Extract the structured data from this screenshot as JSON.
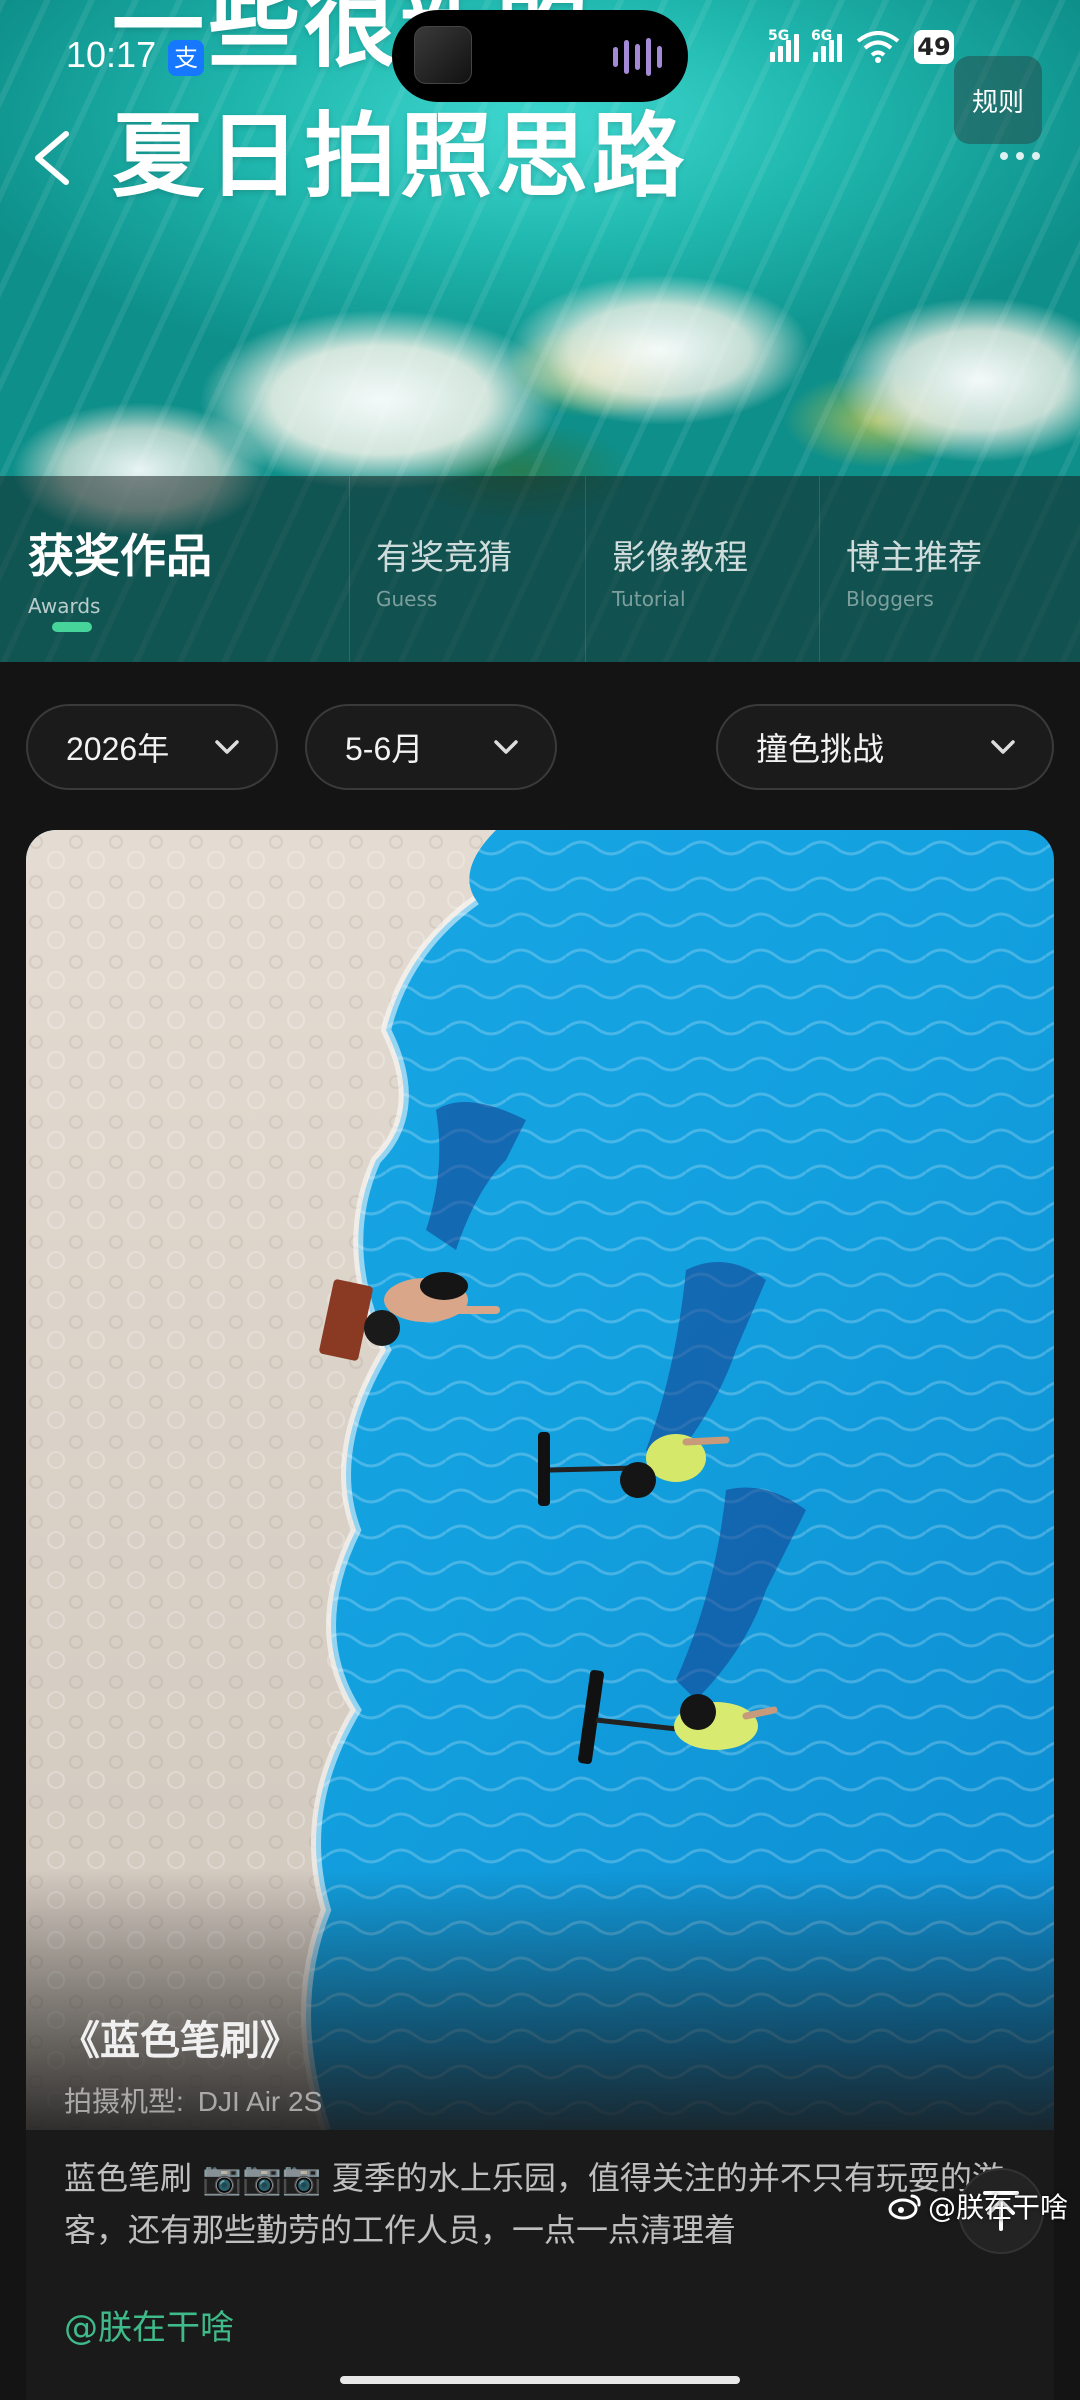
{
  "status_bar": {
    "time": "10:17",
    "signal_tags": [
      "5G",
      "6G"
    ],
    "battery": "49"
  },
  "hero": {
    "title_line1": "一些很新的",
    "title_line2": "夏日拍照思路"
  },
  "rules_button": {
    "label": "规则"
  },
  "tabs": [
    {
      "label": "获奖作品",
      "sub": "Awards",
      "active": true
    },
    {
      "label": "有奖竞猜",
      "sub": "Guess",
      "active": false
    },
    {
      "label": "影像教程",
      "sub": "Tutorial",
      "active": false
    },
    {
      "label": "博主推荐",
      "sub": "Bloggers",
      "active": false
    }
  ],
  "filters": {
    "year": "2026年",
    "period": "5-6月",
    "theme": "撞色挑战"
  },
  "card": {
    "title": "《蓝色笔刷》",
    "camera_label": "拍摄机型:",
    "camera_value": "DJI Air 2S",
    "description": "蓝色笔刷 📷📷📷 夏季的水上乐园，值得关注的并不只有玩耍的游客，还有那些勤劳的工作人员，一点一点清理着",
    "author": "@朕在干啥"
  },
  "watermark": "@朕在干啥",
  "colors": {
    "accent": "#46d49a",
    "author": "#3fba8a",
    "background": "#141414"
  }
}
